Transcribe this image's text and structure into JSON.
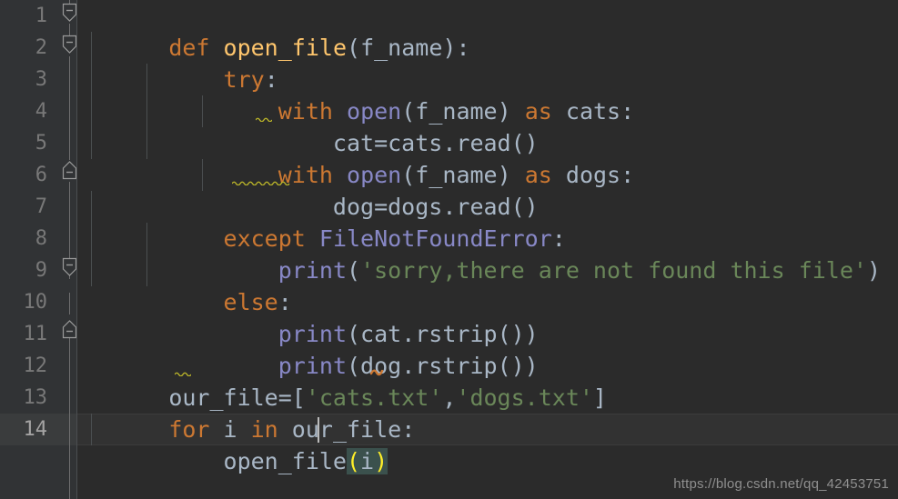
{
  "editor": {
    "app": "pycharm-code-editor",
    "language": "python",
    "theme": "darcula",
    "colors": {
      "background": "#2b2b2b",
      "gutter_background": "#313335",
      "current_line": "#323232",
      "keyword": "#cc7832",
      "function_name": "#ffc66d",
      "builtin": "#8888c6",
      "string": "#6a8759",
      "identifier": "#a9b7c6",
      "line_number": "#787878",
      "brace_match_bg": "#3b514d",
      "brace_match_fg": "#ffef28",
      "warning_squiggle": "#bbb529",
      "error_squiggle": "#cc7832"
    },
    "line_numbers": [
      "1",
      "2",
      "3",
      "4",
      "5",
      "6",
      "7",
      "8",
      "9",
      "10",
      "11",
      "12",
      "13",
      "14"
    ],
    "current_line_number": "14",
    "lines": [
      {
        "n": "1",
        "indent": 0,
        "text": "def open_file(f_name):",
        "tokens": [
          {
            "t": "def",
            "c": "kw"
          },
          {
            "t": " ",
            "c": "id"
          },
          {
            "t": "open_file",
            "c": "fn"
          },
          {
            "t": "(",
            "c": "punc"
          },
          {
            "t": "f_name",
            "c": "id"
          },
          {
            "t": ")",
            "c": "punc"
          },
          {
            "t": ":",
            "c": "punc"
          }
        ]
      },
      {
        "n": "2",
        "indent": 1,
        "text": "    try:",
        "tokens": [
          {
            "t": "    ",
            "c": "id"
          },
          {
            "t": "try",
            "c": "kw"
          },
          {
            "t": ":",
            "c": "punc"
          }
        ]
      },
      {
        "n": "3",
        "indent": 2,
        "text": "        with open(f_name) as cats:",
        "tokens": [
          {
            "t": "        ",
            "c": "id"
          },
          {
            "t": "with",
            "c": "kw"
          },
          {
            "t": " ",
            "c": "id"
          },
          {
            "t": "open",
            "c": "bi"
          },
          {
            "t": "(",
            "c": "punc"
          },
          {
            "t": "f_name",
            "c": "id"
          },
          {
            "t": ")",
            "c": "punc"
          },
          {
            "t": " ",
            "c": "id"
          },
          {
            "t": "as",
            "c": "kw"
          },
          {
            "t": " cats:",
            "c": "id"
          }
        ]
      },
      {
        "n": "4",
        "indent": 3,
        "text": "            cat=cats.read()",
        "tokens": [
          {
            "t": "            cat=cats.read()",
            "c": "id"
          }
        ]
      },
      {
        "n": "5",
        "indent": 2,
        "text": "        with open(f_name) as dogs:",
        "tokens": [
          {
            "t": "        ",
            "c": "id"
          },
          {
            "t": "with",
            "c": "kw"
          },
          {
            "t": " ",
            "c": "id"
          },
          {
            "t": "open",
            "c": "bi"
          },
          {
            "t": "(",
            "c": "punc"
          },
          {
            "t": "f_name",
            "c": "id"
          },
          {
            "t": ")",
            "c": "punc"
          },
          {
            "t": " ",
            "c": "id"
          },
          {
            "t": "as",
            "c": "kw"
          },
          {
            "t": " dogs:",
            "c": "id"
          }
        ]
      },
      {
        "n": "6",
        "indent": 3,
        "text": "            dog=dogs.read()",
        "tokens": [
          {
            "t": "            dog=dogs.read()",
            "c": "id"
          }
        ]
      },
      {
        "n": "7",
        "indent": 1,
        "text": "    except FileNotFoundError:",
        "tokens": [
          {
            "t": "    ",
            "c": "id"
          },
          {
            "t": "except",
            "c": "kw"
          },
          {
            "t": " ",
            "c": "id"
          },
          {
            "t": "FileNotFoundError",
            "c": "bi"
          },
          {
            "t": ":",
            "c": "punc"
          }
        ]
      },
      {
        "n": "8",
        "indent": 2,
        "text": "        print('sorry,there are not found this file')",
        "tokens": [
          {
            "t": "        ",
            "c": "id"
          },
          {
            "t": "print",
            "c": "bi"
          },
          {
            "t": "(",
            "c": "punc"
          },
          {
            "t": "'sorry,there are not found this file'",
            "c": "str"
          },
          {
            "t": ")",
            "c": "punc"
          }
        ]
      },
      {
        "n": "9",
        "indent": 1,
        "text": "    else:",
        "tokens": [
          {
            "t": "    ",
            "c": "id"
          },
          {
            "t": "else",
            "c": "kw"
          },
          {
            "t": ":",
            "c": "punc"
          }
        ]
      },
      {
        "n": "10",
        "indent": 2,
        "text": "        print(cat.rstrip())",
        "tokens": [
          {
            "t": "        ",
            "c": "id"
          },
          {
            "t": "print",
            "c": "bi"
          },
          {
            "t": "(cat.rstrip())",
            "c": "id"
          }
        ]
      },
      {
        "n": "11",
        "indent": 2,
        "text": "        print(dog.rstrip())",
        "tokens": [
          {
            "t": "        ",
            "c": "id"
          },
          {
            "t": "print",
            "c": "bi"
          },
          {
            "t": "(dog.rstrip())",
            "c": "id"
          }
        ]
      },
      {
        "n": "12",
        "indent": 0,
        "text": "our_file=['cats.txt','dogs.txt']",
        "tokens": [
          {
            "t": "our_file=[",
            "c": "id"
          },
          {
            "t": "'cats.txt'",
            "c": "str"
          },
          {
            "t": ",",
            "c": "punc"
          },
          {
            "t": "'dogs.txt'",
            "c": "str"
          },
          {
            "t": "]",
            "c": "punc"
          }
        ]
      },
      {
        "n": "13",
        "indent": 0,
        "text": "for i in our_file:",
        "tokens": [
          {
            "t": "for",
            "c": "kw"
          },
          {
            "t": " i ",
            "c": "id"
          },
          {
            "t": "in",
            "c": "kw"
          },
          {
            "t": " our_file:",
            "c": "id"
          }
        ]
      },
      {
        "n": "14",
        "indent": 1,
        "text": "    open_file(i)",
        "tokens": [
          {
            "t": "    open_file",
            "c": "id"
          },
          {
            "t": "(",
            "c": "brace-hl"
          },
          {
            "t": "i",
            "c": "brace-inner"
          },
          {
            "t": ")",
            "c": "brace-hl"
          }
        ]
      }
    ],
    "fold_markers": [
      {
        "line": "1",
        "direction": "down",
        "glyph": "minus"
      },
      {
        "line": "2",
        "direction": "down",
        "glyph": "minus"
      },
      {
        "line": "6",
        "direction": "up",
        "glyph": "minus"
      },
      {
        "line": "9",
        "direction": "down",
        "glyph": "minus"
      },
      {
        "line": "11",
        "direction": "up",
        "glyph": "minus"
      }
    ],
    "inspections": [
      {
        "line": "4",
        "kind": "weak-warning",
        "under": "="
      },
      {
        "line": "6",
        "kind": "weak-warning",
        "under": "dog="
      },
      {
        "line": "12",
        "kind": "weak-warning",
        "under": "="
      },
      {
        "line": "12",
        "kind": "error",
        "under": ","
      }
    ],
    "caret": {
      "line": "14",
      "column": "17"
    }
  },
  "watermark": {
    "text": "https://blog.csdn.net/qq_42453751"
  }
}
